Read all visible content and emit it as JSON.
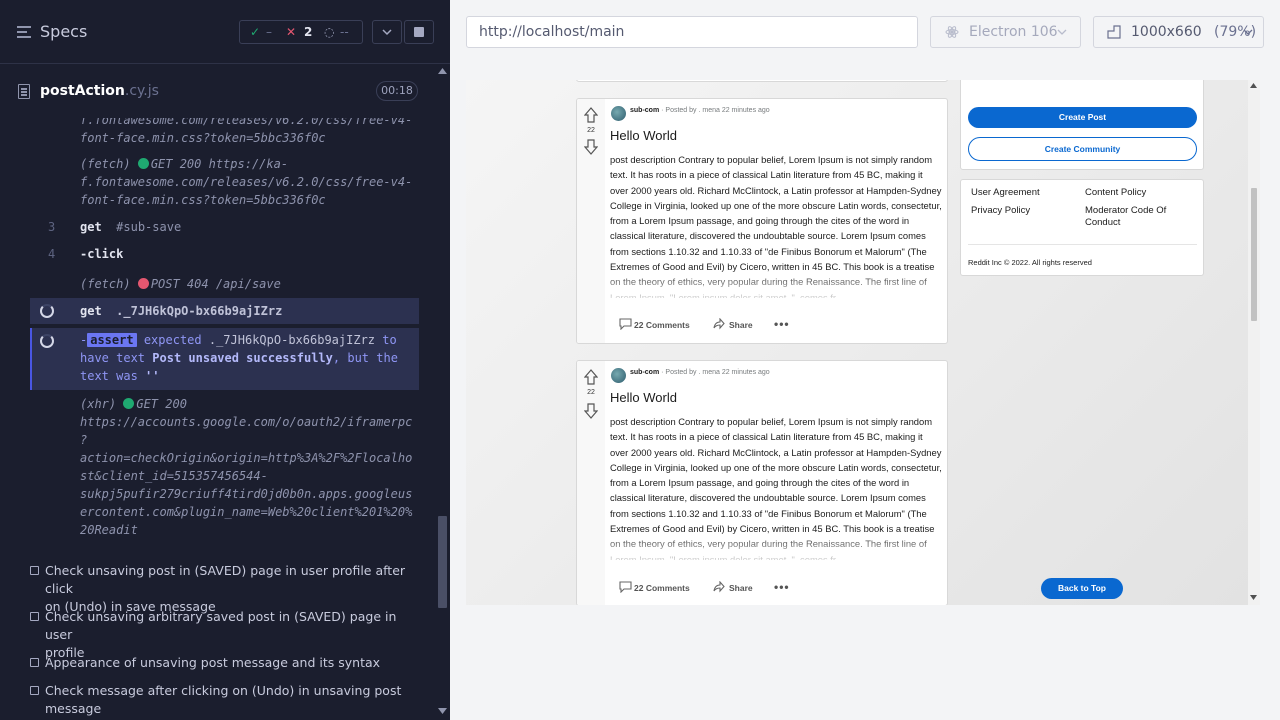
{
  "specs": {
    "title": "Specs",
    "stats": {
      "passed": "–",
      "failed": "2",
      "pending": "--"
    }
  },
  "file": {
    "name": "postAction",
    "ext": ".cy.js",
    "timer": "00:18"
  },
  "commands": {
    "c0_line1": "f.fontawesome.com/releases/v6.2.0/css/free-v4-",
    "c0_line2": "font-face.min.css?token=5bbc336f0c",
    "c1_prefix": "(fetch)",
    "c1_method": "GET 200 https://ka-",
    "c1_line2": "f.fontawesome.com/releases/v6.2.0/css/free-v4-",
    "c1_line3": "font-face.min.css?token=5bbc336f0c",
    "c2_num": "3",
    "c2_cmd": "get",
    "c2_arg": "#sub-save",
    "c3_num": "4",
    "c3_cmd": "-click",
    "c4_prefix": "(fetch)",
    "c4_method": "POST 404 /api/save",
    "c5_cmd": "get",
    "c5_arg": "._7JH6kQpO-bx66b9ajIZrz",
    "c6_dash": "-",
    "c6_tag": "assert",
    "c6_t1": "expected",
    "c6_sel": "._7JH6kQpO-bx66b9ajIZrz",
    "c6_t2": "to",
    "c6_t3": "have text",
    "c6_val": "Post unsaved successfully",
    "c6_t4": ", but the",
    "c6_t5": "text was",
    "c6_empty": "''",
    "c7_prefix": "(xhr)",
    "c7_method": "GET 200",
    "c7_line2": "https://accounts.google.com/o/oauth2/iframerpc",
    "c7_line3": "?",
    "c7_line4": "action=checkOrigin&origin=http%3A%2F%2Flocalho",
    "c7_line5": "st&client_id=515357456544-",
    "c7_line6": "sukpj5pufir279criuff4tird0jd0b0n.apps.googleus",
    "c7_line7": "ercontent.com&plugin_name=Web%20client%201%20%",
    "c7_line8": "20Readit"
  },
  "tests": [
    {
      "line1": "Check unsaving post in (SAVED) page in user profile after click",
      "line2": "on (Undo) in save message"
    },
    {
      "line1": "Check unsaving arbitrary saved post in (SAVED) page in user",
      "line2": "profile"
    },
    {
      "line1": "Appearance of unsaving post message and its syntax",
      "line2": ""
    },
    {
      "line1": "Check message after clicking on (Undo) in unsaving post",
      "line2": "message"
    }
  ],
  "browser": {
    "url": "http://localhost/main",
    "engine": "Electron 106",
    "viewport": "1000x660",
    "zoom": "(79%)"
  },
  "posts": [
    {
      "votes": "22",
      "sub": "sub-com",
      "posted_by": "· Posted by . mena 22 minutes ago",
      "title": "Hello World",
      "desc": "post description Contrary to popular belief, Lorem Ipsum is not simply random text. It has roots in a piece of classical Latin literature from 45 BC, making it over 2000 years old. Richard McClintock, a Latin professor at Hampden-Sydney College in Virginia, looked up one of the more obscure Latin words, consectetur, from a Lorem Ipsum passage, and going through the cites of the word in classical literature, discovered the undoubtable source. Lorem Ipsum comes from sections 1.10.32 and 1.10.33 of \"de Finibus Bonorum et Malorum\" (The Extremes of Good and Evil) by Cicero, written in 45 BC. This book is a treatise on the theory of ethics, very popular during the Renaissance. The first line of Lorem Ipsum, \"Lorem ipsum dolor sit amet..\", comes fr",
      "comments": "22 Comments",
      "share": "Share"
    },
    {
      "votes": "22",
      "sub": "sub-com",
      "posted_by": "· Posted by . mena 22 minutes ago",
      "title": "Hello World",
      "desc": "post description Contrary to popular belief, Lorem Ipsum is not simply random text. It has roots in a piece of classical Latin literature from 45 BC, making it over 2000 years old. Richard McClintock, a Latin professor at Hampden-Sydney College in Virginia, looked up one of the more obscure Latin words, consectetur, from a Lorem Ipsum passage, and going through the cites of the word in classical literature, discovered the undoubtable source. Lorem Ipsum comes from sections 1.10.32 and 1.10.33 of \"de Finibus Bonorum et Malorum\" (The Extremes of Good and Evil) by Cicero, written in 45 BC. This book is a treatise on the theory of ethics, very popular during the Renaissance. The first line of Lorem Ipsum, \"Lorem ipsum dolor sit amet..\", comes fr",
      "comments": "22 Comments",
      "share": "Share"
    }
  ],
  "sidebar": {
    "create_post": "Create Post",
    "create_community": "Create Community",
    "links": {
      "user_agreement": "User Agreement",
      "content_policy": "Content Policy",
      "privacy_policy": "Privacy Policy",
      "moderator_code": "Moderator Code Of Conduct"
    },
    "copyright": "Reddit Inc © 2022. All rights reserved"
  },
  "back_to_top": "Back to Top",
  "colors": {
    "panel_bg": "#1b1e2e",
    "pass": "#1fa971",
    "fail": "#e45770",
    "assert": "#6b76f2",
    "primary": "#0a68d0"
  }
}
